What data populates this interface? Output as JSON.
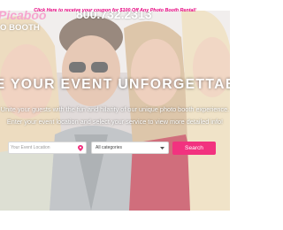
{
  "promo": {
    "text": "Click Here to receive your coupon for $100 Off Any Photo Booth Rental!"
  },
  "brand": {
    "logo_top": "Picaboo",
    "logo_sub": "O BOOTH",
    "phone": "800.732.2313"
  },
  "hero": {
    "headline": "KE YOUR EVENT UNFORGETTABL",
    "subline1": "Unite your guests with the fun and hilarity of our unique photo booth experience.",
    "subline2": "Enter your event location and select your service to view more detailed info!"
  },
  "search": {
    "location_placeholder": "Your Event Location",
    "category_selected": "All categories",
    "button_label": "Search"
  },
  "colors": {
    "accent_pink": "#f2327f",
    "promo_pink": "#e6007e",
    "logo_pink": "#f6a6cf"
  },
  "icons": {
    "location": "map-pin-icon",
    "dropdown": "chevron-down-icon"
  }
}
